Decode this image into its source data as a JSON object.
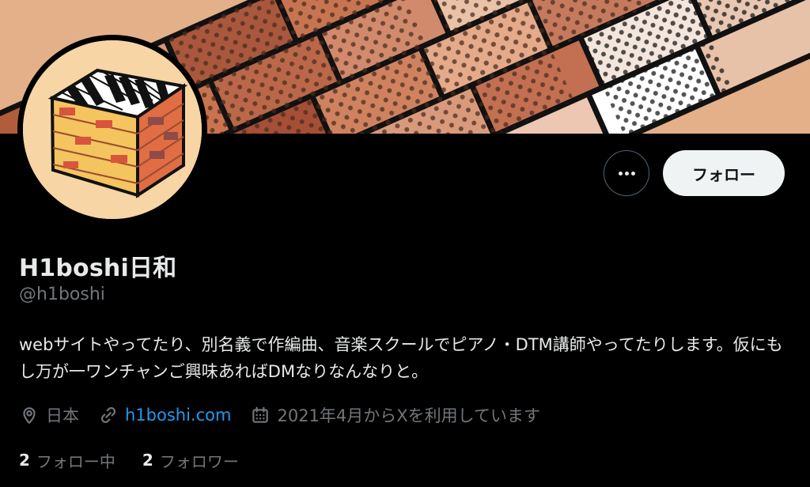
{
  "profile": {
    "display_name": "H1boshi日和",
    "handle": "@h1boshi",
    "bio": "webサイトやってたり、別名義で作編曲、音楽スクールでピアノ・DTM講師やってたりします。仮にもし万が一ワンチャンご興味あればDMなりなんなりと。",
    "location": "日本",
    "website": "h1boshi.com",
    "joined": "2021年4月からXを利用しています"
  },
  "actions": {
    "more_icon": "more-horizontal-icon",
    "follow_label": "フォロー"
  },
  "stats": {
    "following_count": "2",
    "following_label": "フォロー中",
    "followers_count": "2",
    "followers_label": "フォロワー"
  },
  "icons": {
    "location": "location-pin-icon",
    "link": "link-icon",
    "calendar": "calendar-icon"
  },
  "colors": {
    "background": "#000000",
    "primary_text": "#e7e9ea",
    "secondary_text": "#71767b",
    "link": "#1d9bf0",
    "follow_button_bg": "#eff3f4",
    "follow_button_text": "#0f1419"
  }
}
